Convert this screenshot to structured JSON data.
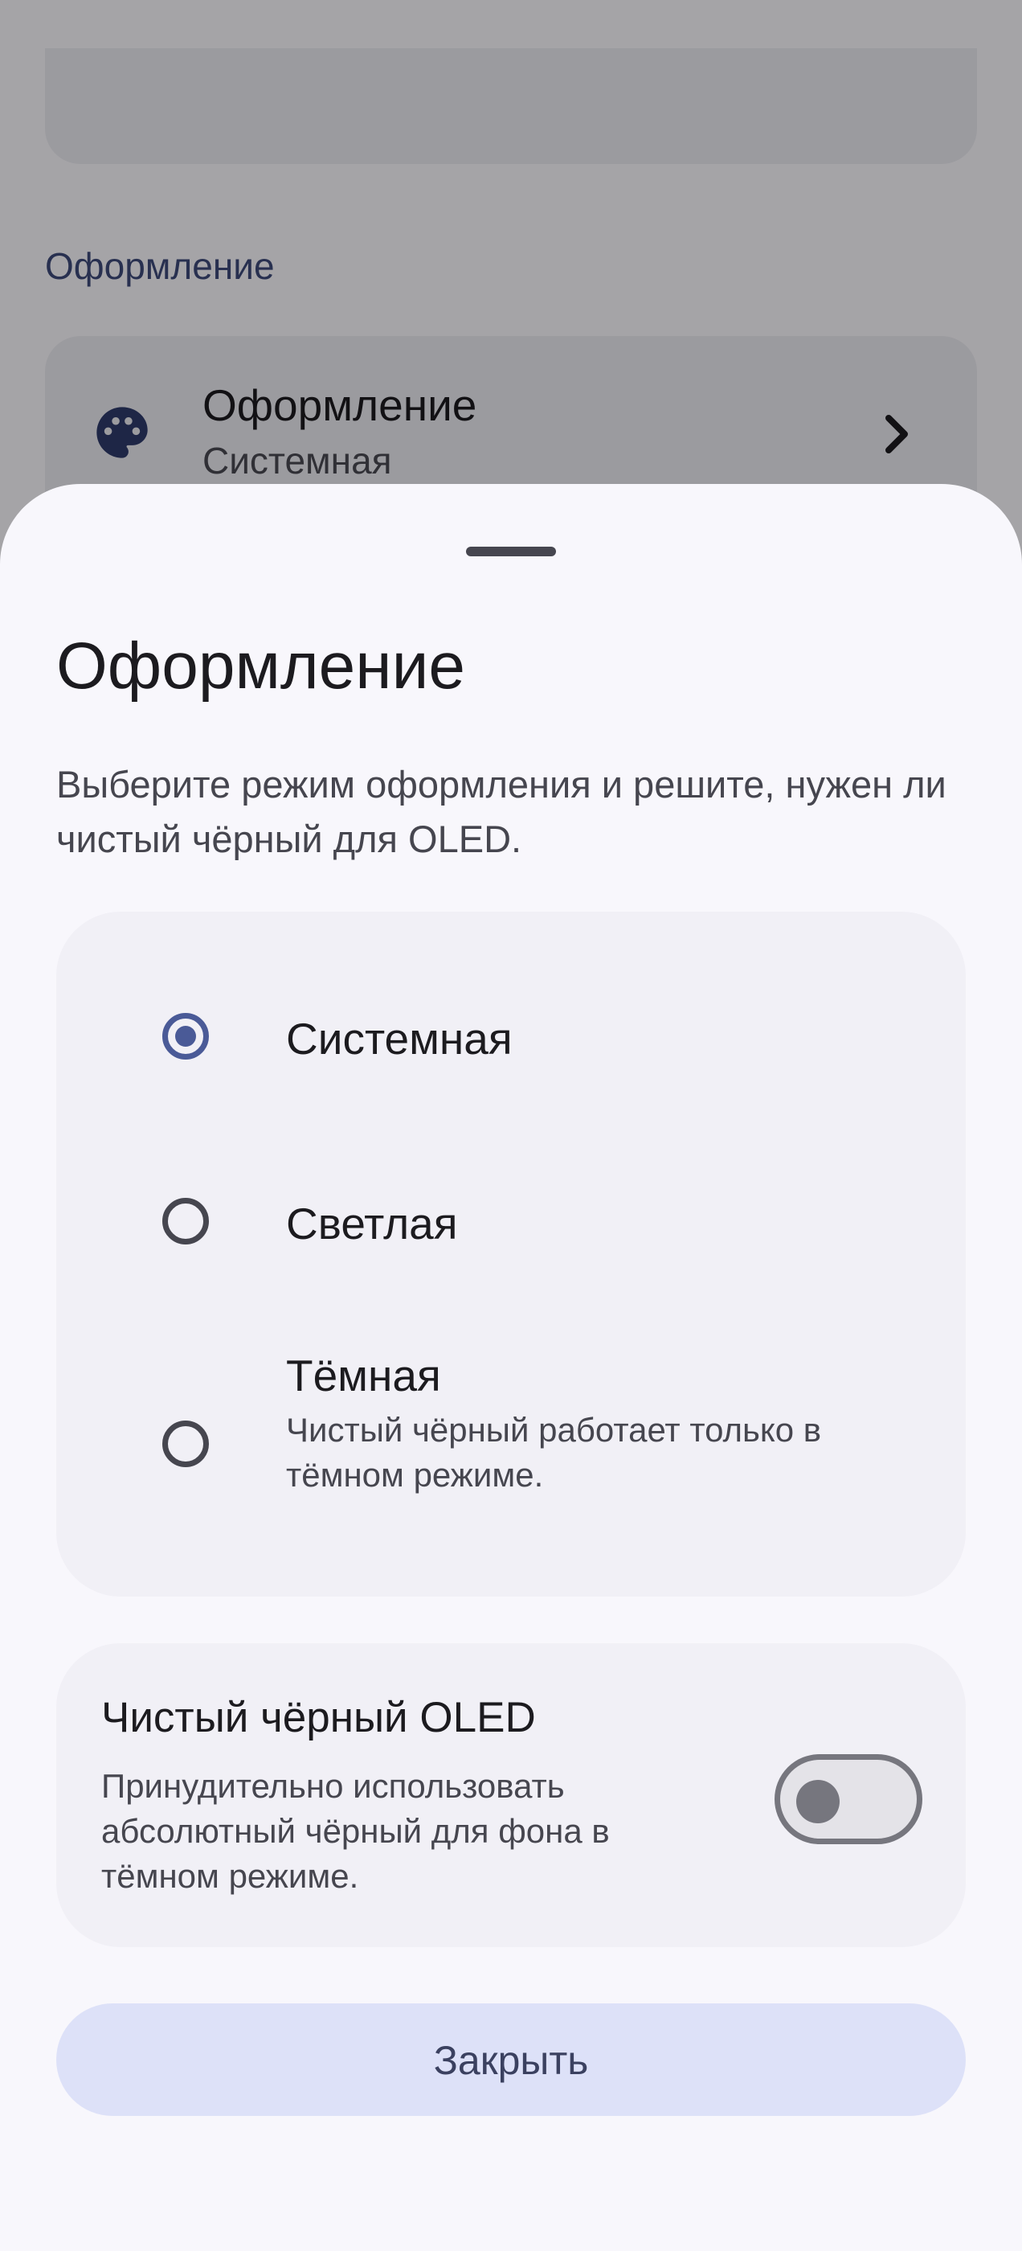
{
  "background": {
    "section_title": "Оформление",
    "item": {
      "title": "Оформление",
      "subtitle": "Системная",
      "icon": "palette-icon"
    }
  },
  "sheet": {
    "title": "Оформление",
    "description": "Выберите режим оформления и решите, нужен ли чистый чёрный для OLED.",
    "options": [
      {
        "label": "Системная",
        "selected": true
      },
      {
        "label": "Светлая",
        "selected": false
      },
      {
        "label": "Тёмная",
        "sublabel": "Чистый чёрный работает только в тёмном режиме.",
        "selected": false
      }
    ],
    "oled": {
      "title": "Чистый чёрный OLED",
      "description": "Принудительно использовать абсолютный чёрный для фона в тёмном режиме.",
      "enabled": false
    },
    "close_label": "Закрыть"
  },
  "colors": {
    "accent": "#4a5a97",
    "button_bg": "#dde1f8",
    "sheet_bg": "#f8f7fc"
  }
}
